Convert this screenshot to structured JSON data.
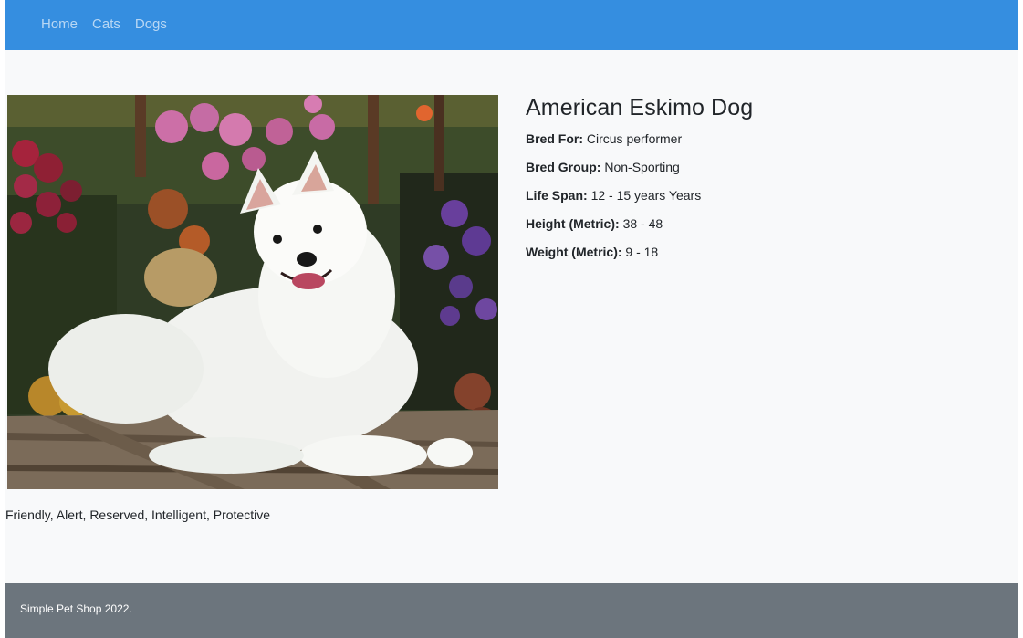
{
  "nav": {
    "links": [
      {
        "label": "Home"
      },
      {
        "label": "Cats"
      },
      {
        "label": "Dogs"
      }
    ]
  },
  "breed": {
    "name": "American Eskimo Dog",
    "details": [
      {
        "label": "Bred For:",
        "value": "Circus performer"
      },
      {
        "label": "Bred Group:",
        "value": "Non-Sporting"
      },
      {
        "label": "Life Span:",
        "value": "12 - 15 years Years"
      },
      {
        "label": "Height (Metric):",
        "value": "38 - 48"
      },
      {
        "label": "Weight (Metric):",
        "value": "9 - 18"
      }
    ],
    "temperament": "Friendly, Alert, Reserved, Intelligent, Protective"
  },
  "footer": {
    "text": "Simple Pet Shop 2022."
  },
  "colors": {
    "navbar": "#358ee0",
    "footer": "#6c757d",
    "page_background": "#f8f9fa"
  }
}
